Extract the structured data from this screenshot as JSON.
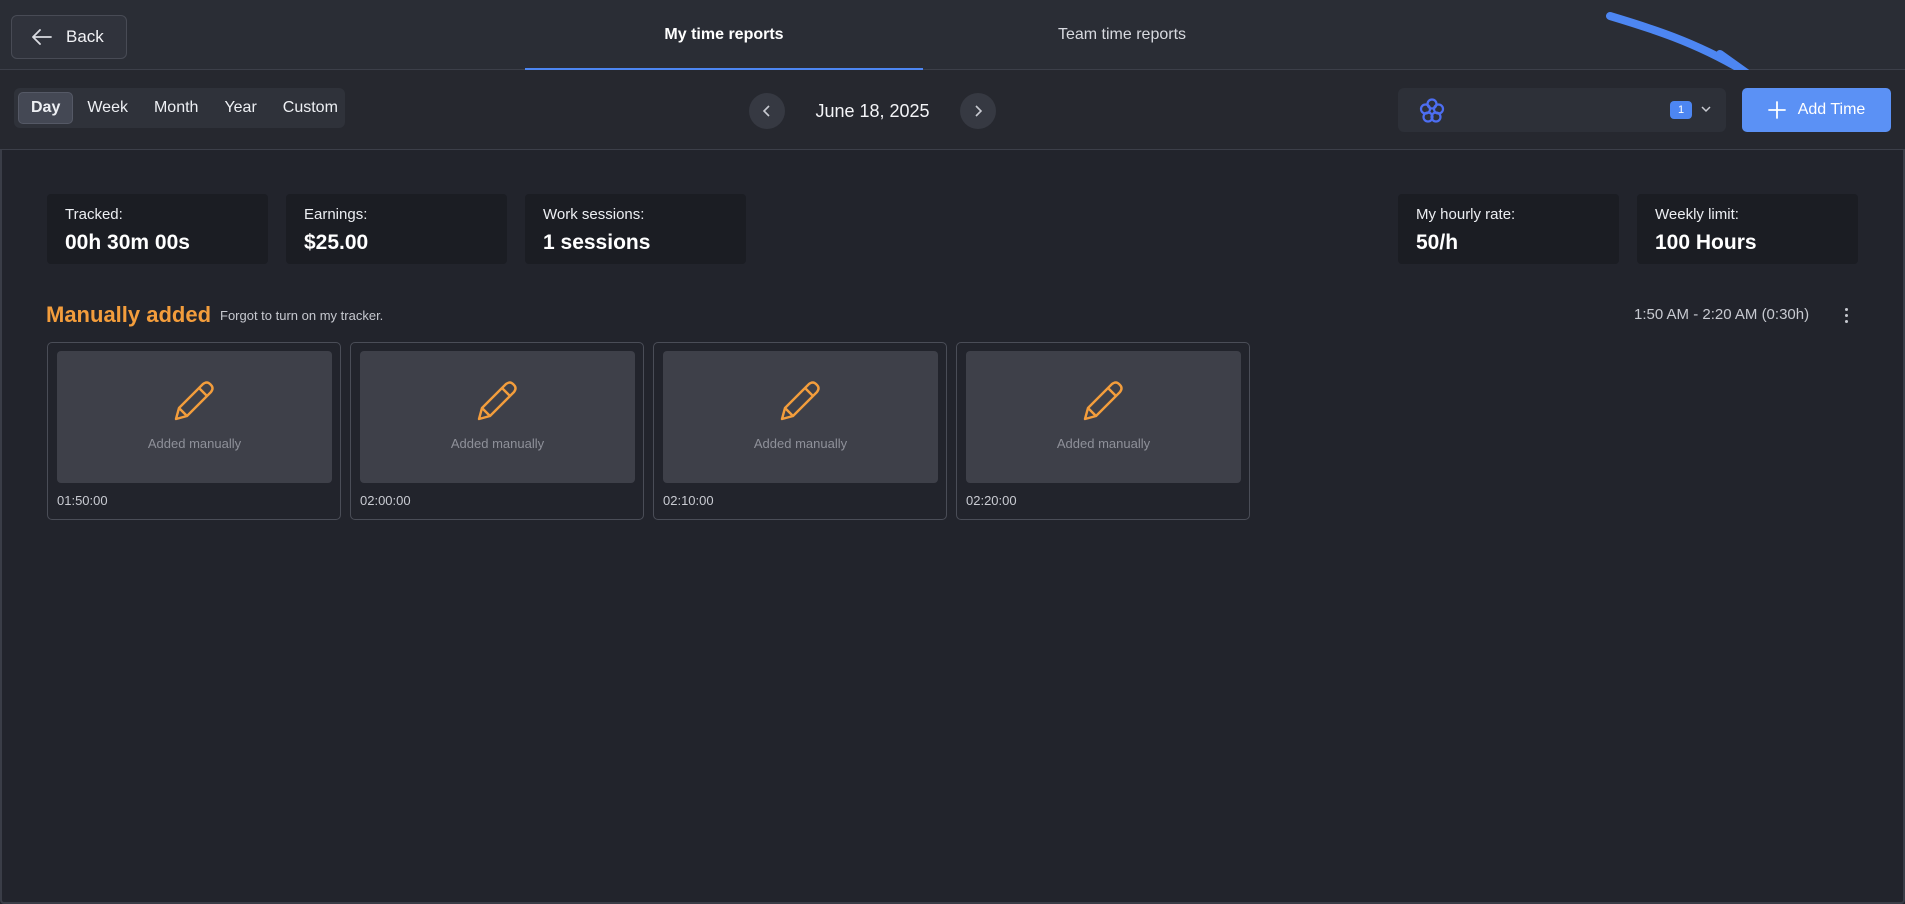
{
  "header": {
    "back_label": "Back",
    "tabs": [
      {
        "label": "My time reports",
        "active": true
      },
      {
        "label": "Team time reports",
        "active": false
      }
    ]
  },
  "toolbar": {
    "periods": [
      "Day",
      "Week",
      "Month",
      "Year",
      "Custom"
    ],
    "active_period": "Day",
    "date": "June 18, 2025",
    "project_select": {
      "count": "1",
      "icon": "project-flower-icon"
    },
    "add_time_label": "Add Time"
  },
  "stats": [
    {
      "label": "Tracked:",
      "value": "00h 30m 00s"
    },
    {
      "label": "Earnings:",
      "value": "$25.00"
    },
    {
      "label": "Work sessions:",
      "value": "1 sessions"
    },
    {
      "label": "My hourly rate:",
      "value": "50/h"
    },
    {
      "label": "Weekly limit:",
      "value": "100 Hours"
    }
  ],
  "session": {
    "title": "Manually added",
    "note": "Forgot to turn on my tracker.",
    "range": "1:50 AM - 2:20 AM (0:30h)",
    "entries": [
      {
        "caption": "Added manually",
        "time": "01:50:00"
      },
      {
        "caption": "Added manually",
        "time": "02:00:00"
      },
      {
        "caption": "Added manually",
        "time": "02:10:00"
      },
      {
        "caption": "Added manually",
        "time": "02:20:00"
      }
    ]
  },
  "colors": {
    "accent": "#4d86f2",
    "add_button": "#5b91f5",
    "session_title": "#f39d3c",
    "background": "#22242c"
  }
}
